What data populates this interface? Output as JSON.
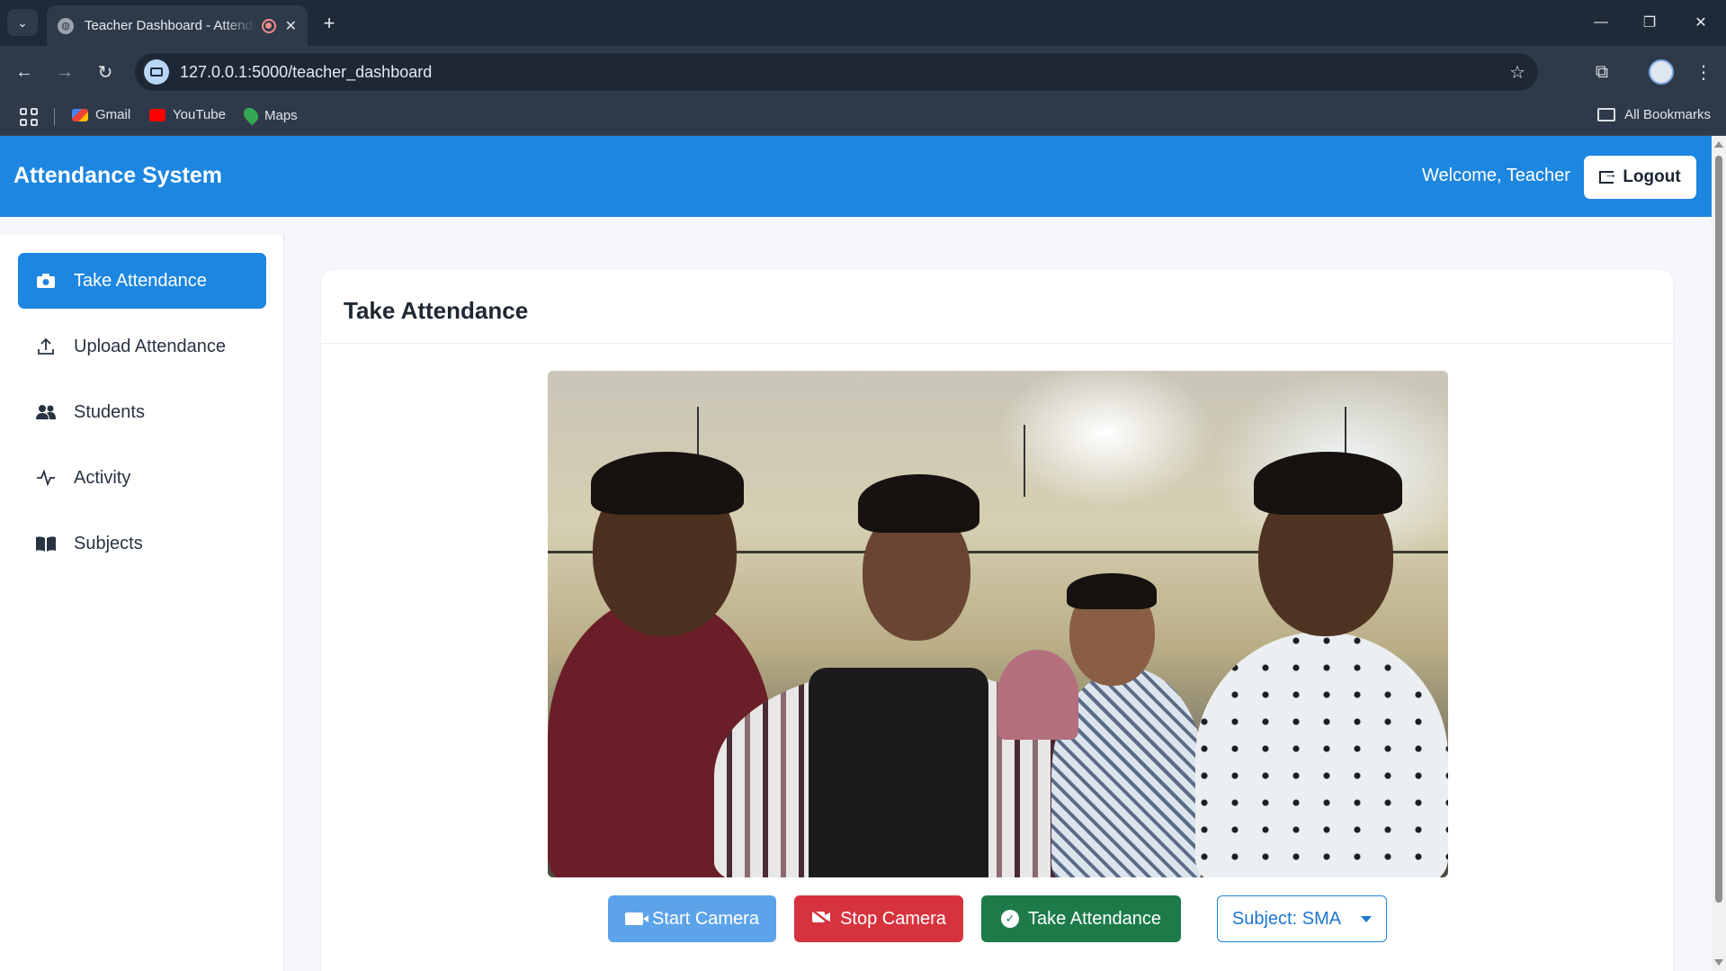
{
  "browser": {
    "tab_title": "Teacher Dashboard - Attendance System",
    "url": "127.0.0.1:5000/teacher_dashboard",
    "new_tab": "+",
    "bookmarks": [
      {
        "label": "Gmail",
        "color": "#ea4335"
      },
      {
        "label": "YouTube",
        "color": "#ff0000"
      },
      {
        "label": "Maps",
        "color": "#34a853"
      }
    ],
    "all_bookmarks": "All Bookmarks"
  },
  "app": {
    "brand": "Attendance System",
    "welcome": "Welcome, Teacher",
    "logout": "Logout",
    "accent_color": "#1d86e0"
  },
  "sidebar": {
    "items": [
      {
        "label": "Take Attendance",
        "icon": "camera-icon",
        "active": true
      },
      {
        "label": "Upload Attendance",
        "icon": "upload-icon",
        "active": false
      },
      {
        "label": "Students",
        "icon": "users-icon",
        "active": false
      },
      {
        "label": "Activity",
        "icon": "activity-icon",
        "active": false
      },
      {
        "label": "Subjects",
        "icon": "book-icon",
        "active": false
      }
    ]
  },
  "main": {
    "card_title": "Take Attendance",
    "buttons": {
      "start_camera": "Start Camera",
      "stop_camera": "Stop Camera",
      "take_attendance": "Take Attendance",
      "subject": "Subject: SMA"
    }
  }
}
